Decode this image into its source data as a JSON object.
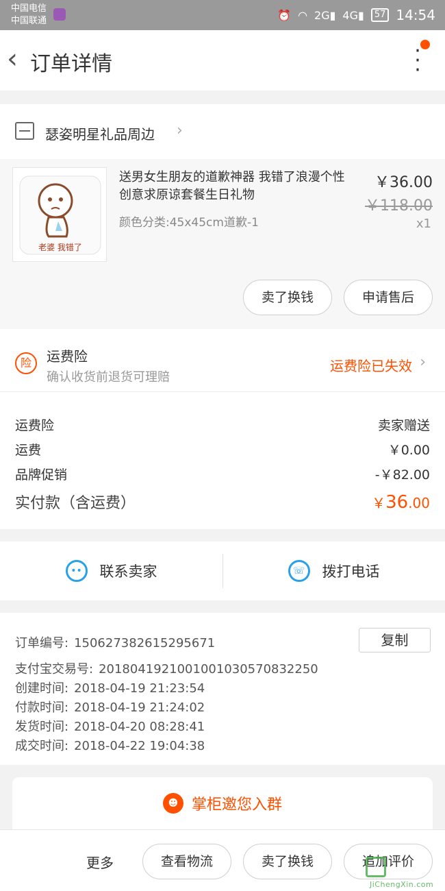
{
  "status_bar": {
    "carrier_1": "中国电信",
    "carrier_2": "中国联通",
    "net_2g": "2G",
    "net_4g": "4G",
    "battery": "57",
    "time": "14:54"
  },
  "header": {
    "title": "订单详情"
  },
  "shop": {
    "name": "瑟姿明星礼品周边"
  },
  "item": {
    "title": "送男女生朋友的道歉神器 我错了浪漫个性创意求原谅套餐生日礼物",
    "spec": "颜色分类:45x45cm道歉-1",
    "price": "￥36.00",
    "original_price": "￥118.00",
    "quantity": "x1",
    "image_text": "老婆 我错了",
    "buttons": {
      "resell": "卖了换钱",
      "after_sale": "申请售后"
    }
  },
  "insurance": {
    "icon_label": "险",
    "title": "运费险",
    "subtitle": "确认收货前退货可理赔",
    "status": "运费险已失效"
  },
  "fees": [
    {
      "label": "运费险",
      "value": "卖家赠送"
    },
    {
      "label": "运费",
      "value": "￥0.00"
    },
    {
      "label": "品牌促销",
      "value": "-￥82.00"
    }
  ],
  "total": {
    "label": "实付款（含运费）",
    "symbol": "￥",
    "integer": "36",
    "decimal": ".00"
  },
  "contact": {
    "seller": "联系卖家",
    "call": "拨打电话"
  },
  "order": {
    "copy_button": "复制",
    "lines": [
      {
        "label": "订单编号:",
        "value": "150627382615295671"
      },
      {
        "label": "支付宝交易号:",
        "value": "2018041921001001030570832250"
      },
      {
        "label": "创建时间:",
        "value": "2018-04-19 21:23:54"
      },
      {
        "label": "付款时间:",
        "value": "2018-04-19 21:24:02"
      },
      {
        "label": "发货时间:",
        "value": "2018-04-20 08:28:41"
      },
      {
        "label": "成交时间:",
        "value": "2018-04-22 19:04:38"
      }
    ]
  },
  "group": {
    "text": "掌柜邀您入群"
  },
  "bottom_bar": {
    "more": "更多",
    "logistics": "查看物流",
    "resell": "卖了换钱",
    "review": "追加评价"
  },
  "watermark": {
    "text": "JiChengXin.com"
  },
  "colors": {
    "accent": "#ff5000",
    "contact_blue": "#29a0e8",
    "statusbar": "#9a9a9a"
  }
}
